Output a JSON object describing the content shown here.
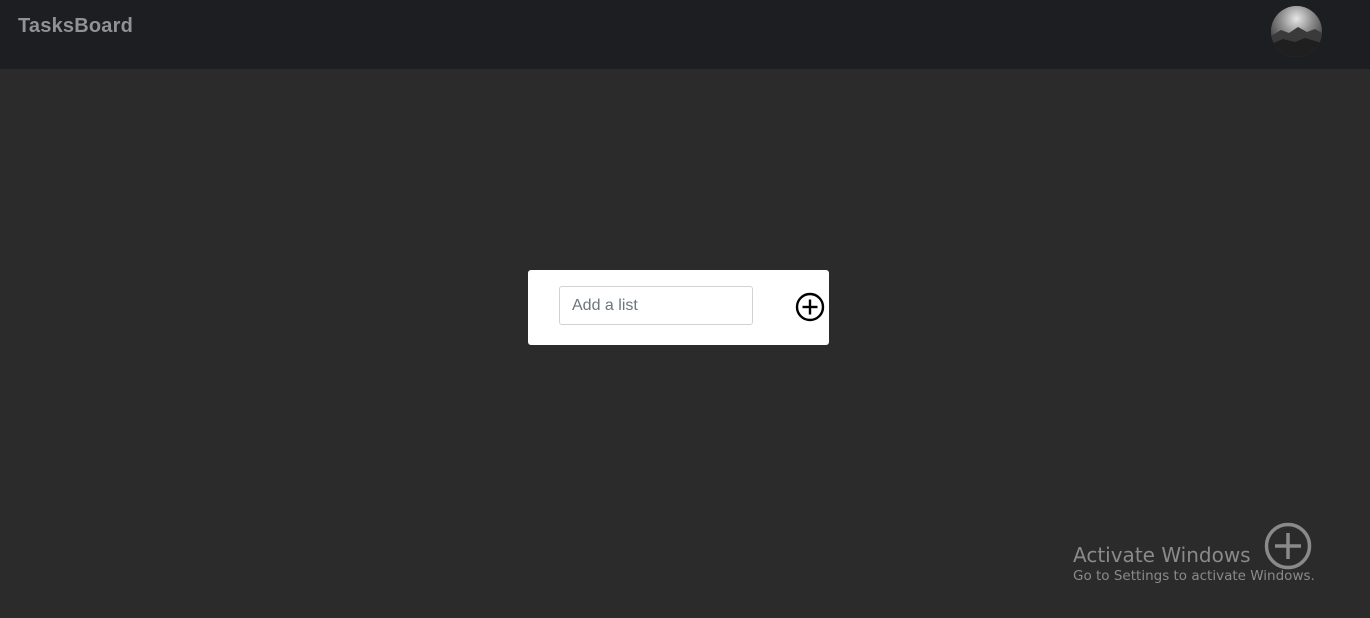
{
  "navbar": {
    "brand": "TasksBoard",
    "avatar_icon": "user-avatar-photo"
  },
  "add_list": {
    "placeholder": "Add a list",
    "value": "",
    "add_icon": "plus-circle-icon"
  },
  "fab": {
    "icon": "plus-circle-icon"
  },
  "watermark": {
    "title": "Activate Windows",
    "subtitle": "Go to Settings to activate Windows."
  },
  "colors": {
    "background": "#2b2b2b",
    "navbar": "#1c1e21",
    "brand_text": "#8f9296",
    "card": "#ffffff"
  }
}
